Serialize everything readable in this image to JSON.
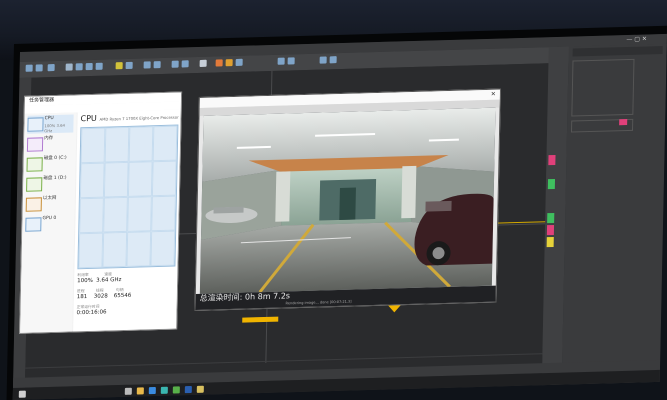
{
  "max_ui": {
    "title_text": "",
    "status_left": "",
    "colors": {
      "accent_pink": "#e0407a",
      "accent_green": "#3fbf5f",
      "orange": "#f0b400"
    },
    "right_panel": {
      "labels": [
        "",
        "",
        "",
        "",
        "",
        "",
        "",
        "",
        "",
        ""
      ]
    }
  },
  "task_manager": {
    "title": "任务管理器",
    "cpu_heading": "CPU",
    "cpu_model": "AMD Ryzen 7 1700X Eight-Core Processor",
    "sidebar": [
      {
        "label": "CPU",
        "sub": "100% 3.64 GHz"
      },
      {
        "label": "内存",
        "sub": ""
      },
      {
        "label": "磁盘 0 (C:)",
        "sub": ""
      },
      {
        "label": "磁盘 1 (D:)",
        "sub": ""
      },
      {
        "label": "以太网",
        "sub": ""
      },
      {
        "label": "GPU 0",
        "sub": ""
      }
    ],
    "stats": {
      "utilization": "100%",
      "speed": "3.64 GHz",
      "processes": "181",
      "threads": "3028",
      "handles": "65546",
      "uptime": "0:00:16:06"
    },
    "cpu_util_fraction": 1.0
  },
  "render_window": {
    "elapsed_label": "总渲染时间:",
    "elapsed_value": "0h  8m  7.2s",
    "progress_text": "Rendering image... done [00:07:21.3]"
  },
  "taskbar": {
    "apps": [
      "start-icon",
      "search-icon",
      "explorer-icon",
      "browser-icon",
      "max-icon",
      "taskmgr-icon",
      "photo-icon",
      "folder-icon"
    ]
  }
}
